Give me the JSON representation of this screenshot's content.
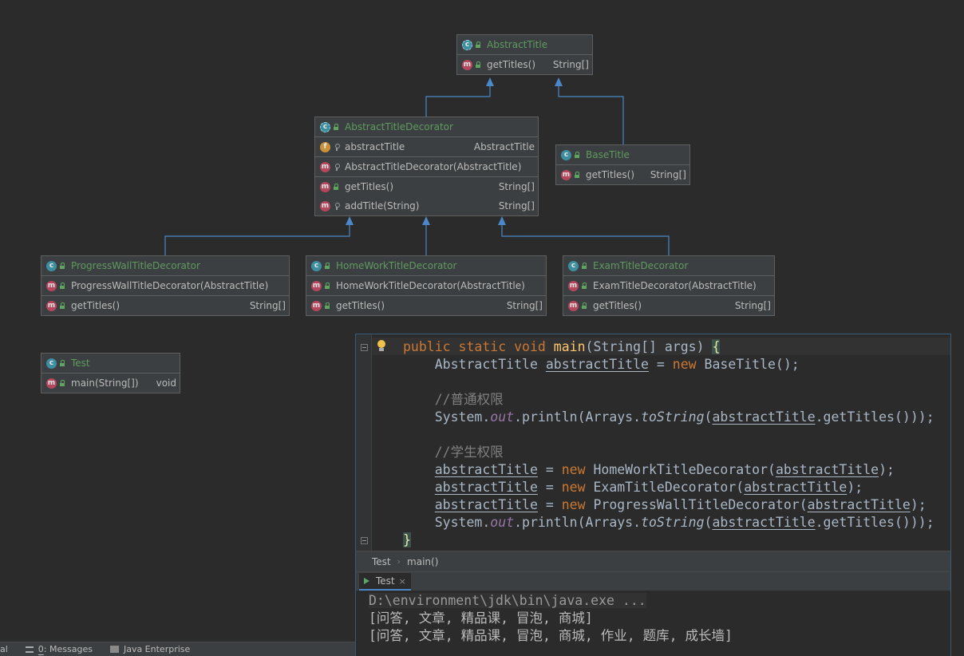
{
  "diagram": {
    "classes": [
      {
        "id": "abstract-title",
        "name": "AbstractTitle",
        "kind": "abstract",
        "sections": [
          [
            {
              "icon": "m",
              "vis": "pub",
              "name": "getTitles()",
              "type": "String[]"
            }
          ]
        ]
      },
      {
        "id": "abstract-title-decorator",
        "name": "AbstractTitleDecorator",
        "kind": "abstract",
        "sections": [
          [
            {
              "icon": "f",
              "vis": "prot",
              "name": "abstractTitle",
              "type": "AbstractTitle"
            }
          ],
          [
            {
              "icon": "m",
              "vis": "prot",
              "name": "AbstractTitleDecorator(AbstractTitle)",
              "type": ""
            }
          ],
          [
            {
              "icon": "m",
              "vis": "pub",
              "name": "getTitles()",
              "type": "String[]"
            },
            {
              "icon": "m",
              "vis": "prot",
              "name": "addTitle(String)",
              "type": "String[]"
            }
          ]
        ]
      },
      {
        "id": "base-title",
        "name": "BaseTitle",
        "kind": "class",
        "sections": [
          [
            {
              "icon": "m",
              "vis": "pub",
              "name": "getTitles()",
              "type": "String[]"
            }
          ]
        ]
      },
      {
        "id": "progress-wall-title-decorator",
        "name": "ProgressWallTitleDecorator",
        "kind": "class",
        "sections": [
          [
            {
              "icon": "m",
              "vis": "pub",
              "name": "ProgressWallTitleDecorator(AbstractTitle)",
              "type": ""
            }
          ],
          [
            {
              "icon": "m",
              "vis": "pub",
              "name": "getTitles()",
              "type": "String[]"
            }
          ]
        ]
      },
      {
        "id": "home-work-title-decorator",
        "name": "HomeWorkTitleDecorator",
        "kind": "class",
        "sections": [
          [
            {
              "icon": "m",
              "vis": "pub",
              "name": "HomeWorkTitleDecorator(AbstractTitle)",
              "type": ""
            }
          ],
          [
            {
              "icon": "m",
              "vis": "pub",
              "name": "getTitles()",
              "type": "String[]"
            }
          ]
        ]
      },
      {
        "id": "exam-title-decorator",
        "name": "ExamTitleDecorator",
        "kind": "class",
        "sections": [
          [
            {
              "icon": "m",
              "vis": "pub",
              "name": "ExamTitleDecorator(AbstractTitle)",
              "type": ""
            }
          ],
          [
            {
              "icon": "m",
              "vis": "pub",
              "name": "getTitles()",
              "type": "String[]"
            }
          ]
        ]
      },
      {
        "id": "test",
        "name": "Test",
        "kind": "test",
        "sections": [
          [
            {
              "icon": "m",
              "vis": "pub",
              "name": "main(String[])",
              "type": "void"
            }
          ]
        ]
      }
    ]
  },
  "editor": {
    "line1": {
      "public": "public",
      "static": "static",
      "void": "void",
      "main": "main",
      "params": "(String[] args) ",
      "brace": "{"
    },
    "line2": {
      "type": "AbstractTitle ",
      "var": "abstractTitle",
      "eq": " = ",
      "new": "new",
      "ctor": " BaseTitle();"
    },
    "comment1": "//普通权限",
    "comment2": "//学生权限",
    "print": {
      "sys": "System.",
      "out": "out",
      "println": ".println(Arrays.",
      "toString": "toString",
      "open": "(",
      "var": "abstractTitle",
      "close": ".getTitles()));"
    },
    "assign": [
      {
        "var": "abstractTitle",
        "eq": " = ",
        "new": "new",
        "ctor": " HomeWorkTitleDecorator(",
        "arg": "abstractTitle",
        "end": ");"
      },
      {
        "var": "abstractTitle",
        "eq": " = ",
        "new": "new",
        "ctor": " ExamTitleDecorator(",
        "arg": "abstractTitle",
        "end": ");"
      },
      {
        "var": "abstractTitle",
        "eq": " = ",
        "new": "new",
        "ctor": " ProgressWallTitleDecorator(",
        "arg": "abstractTitle",
        "end": ");"
      }
    ],
    "end_brace": "}"
  },
  "breadcrumb": {
    "class": "Test",
    "method": "main()"
  },
  "run": {
    "tab_label": "Test",
    "close": "×",
    "lines": [
      "D:\\environment\\jdk\\bin\\java.exe ...",
      "[问答, 文章, 精品课, 冒泡, 商城]",
      "[问答, 文章, 精品课, 冒泡, 商城, 作业, 题库, 成长墙]"
    ]
  },
  "statusbar": {
    "partial": "al",
    "messages_key": "0",
    "messages": ": Messages",
    "java_enterprise": "Java Enterprise"
  },
  "colors": {
    "accent": "#4a88c7",
    "class_name": "#5f9a5f",
    "keyword": "#cc7832",
    "method_decl": "#ffc66d",
    "static_field": "#9876aa"
  }
}
